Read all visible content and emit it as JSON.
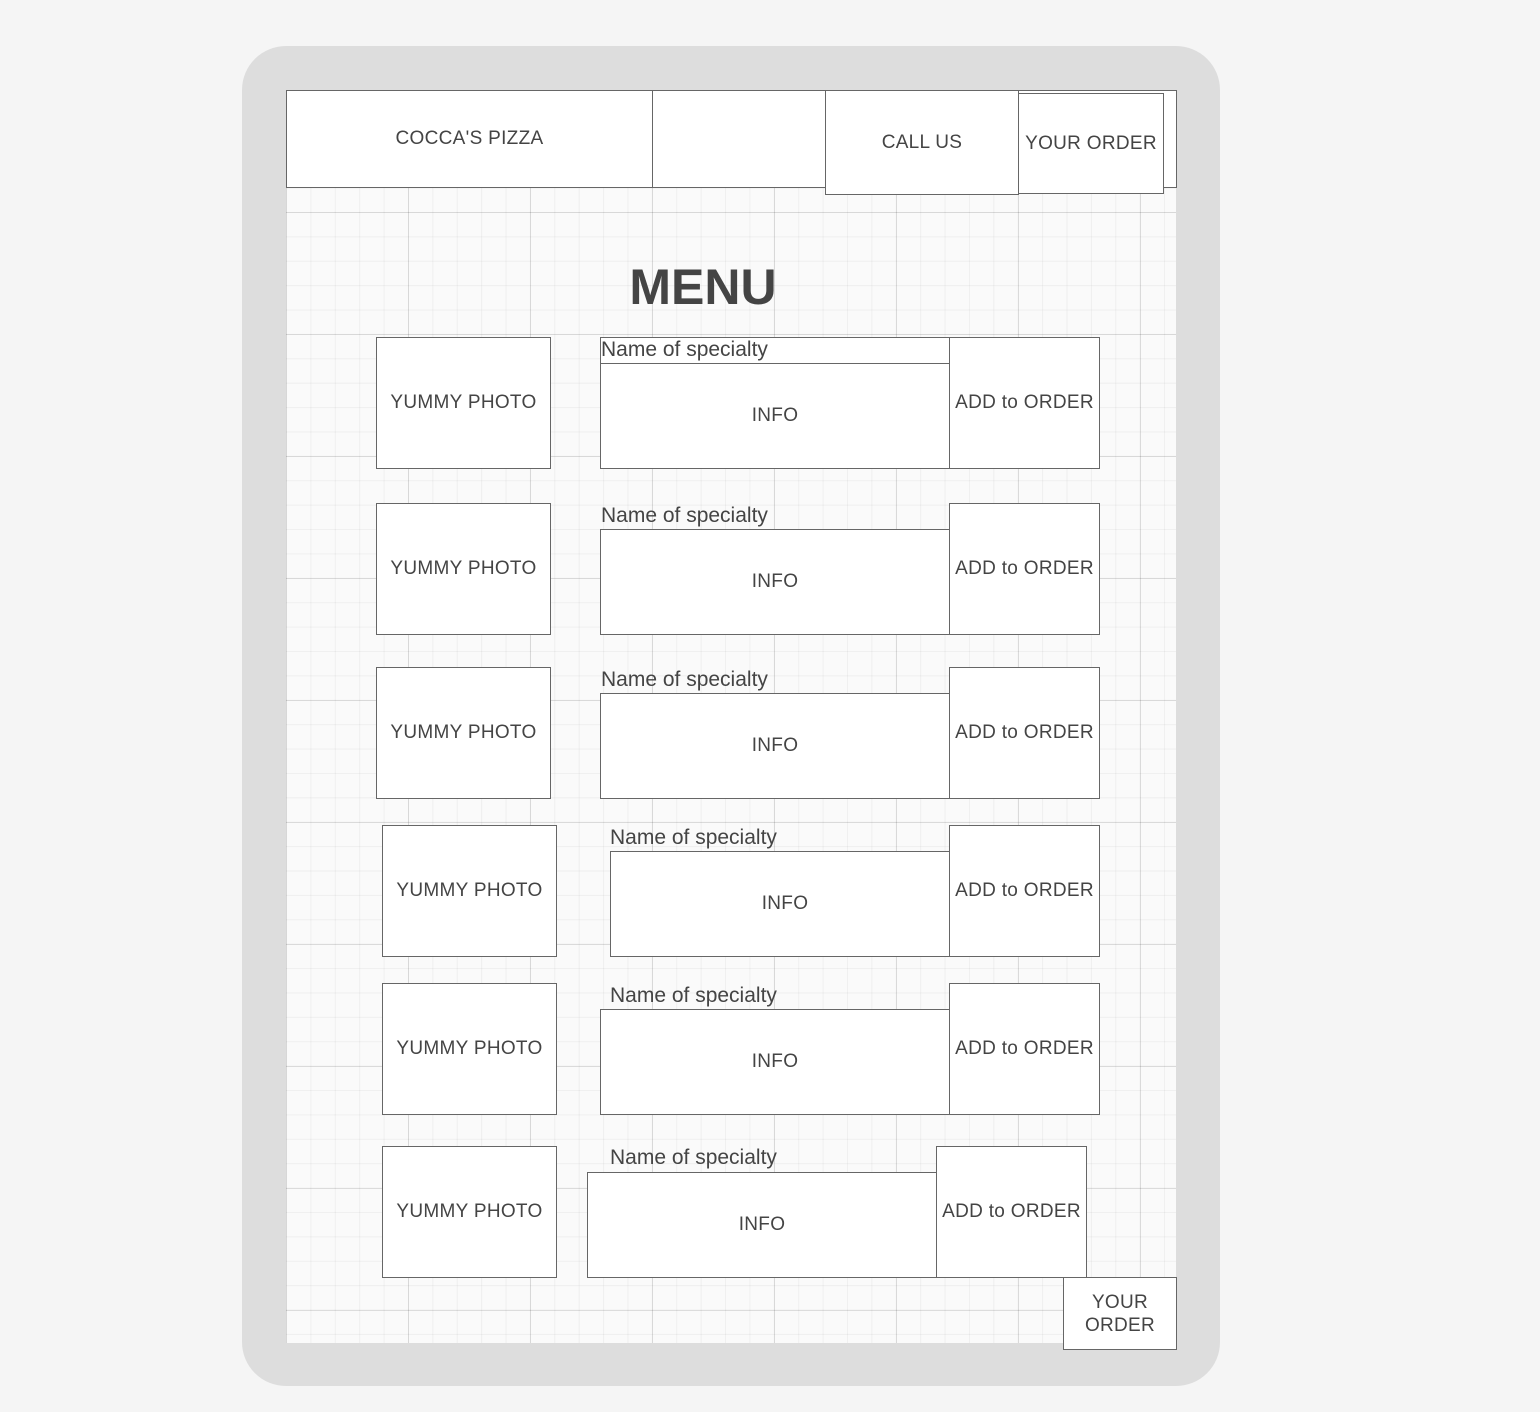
{
  "header": {
    "brand": "COCCA'S PIZZA",
    "call_us": "CALL US",
    "your_order": "YOUR ORDER"
  },
  "menu": {
    "title": "MENU",
    "items": [
      {
        "photo": "YUMMY PHOTO",
        "name": "Name of specialty",
        "info": "INFO",
        "add": "ADD to ORDER"
      },
      {
        "photo": "YUMMY PHOTO",
        "name": "Name of specialty",
        "info": "INFO",
        "add": "ADD to ORDER"
      },
      {
        "photo": "YUMMY PHOTO",
        "name": "Name of specialty",
        "info": "INFO",
        "add": "ADD to ORDER"
      },
      {
        "photo": "YUMMY PHOTO",
        "name": "Name of specialty",
        "info": "INFO",
        "add": "ADD to ORDER"
      },
      {
        "photo": "YUMMY PHOTO",
        "name": "Name of specialty",
        "info": "INFO",
        "add": "ADD to ORDER"
      },
      {
        "photo": "YUMMY PHOTO",
        "name": "Name of specialty",
        "info": "INFO",
        "add": "ADD to ORDER"
      }
    ]
  },
  "footer": {
    "your_order_line1": "YOUR",
    "your_order_line2": "ORDER"
  }
}
